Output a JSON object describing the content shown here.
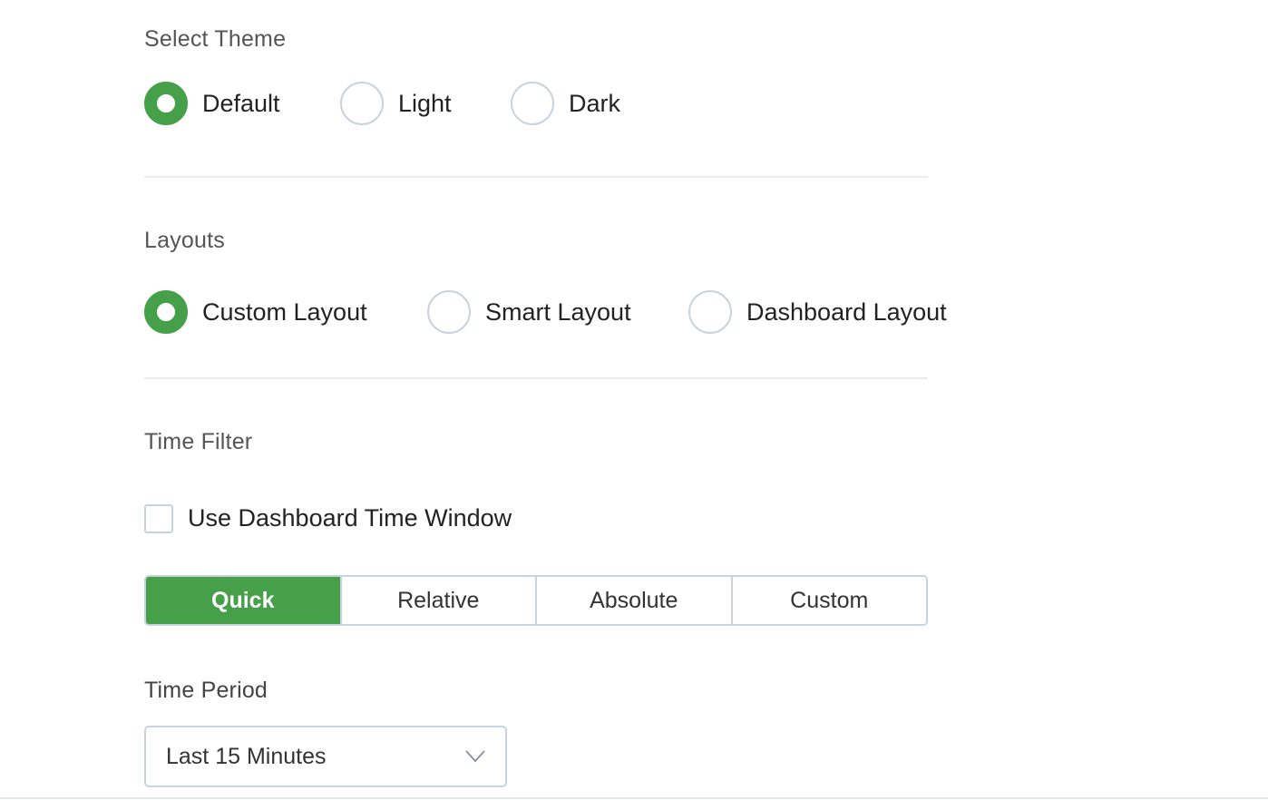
{
  "theme": {
    "label": "Select Theme",
    "options": [
      "Default",
      "Light",
      "Dark"
    ],
    "selected": "Default"
  },
  "layouts": {
    "label": "Layouts",
    "options": [
      "Custom Layout",
      "Smart Layout",
      "Dashboard Layout"
    ],
    "selected": "Custom Layout"
  },
  "time_filter": {
    "label": "Time Filter",
    "checkbox_label": "Use Dashboard Time Window",
    "checkbox_checked": false,
    "tabs": [
      "Quick",
      "Relative",
      "Absolute",
      "Custom"
    ],
    "active_tab": "Quick"
  },
  "time_period": {
    "label": "Time Period",
    "value": "Last 15 Minutes"
  },
  "colors": {
    "accent": "#46a049",
    "border": "#c9d3df"
  },
  "icons": {
    "dropdown": "chevron-down-icon"
  }
}
